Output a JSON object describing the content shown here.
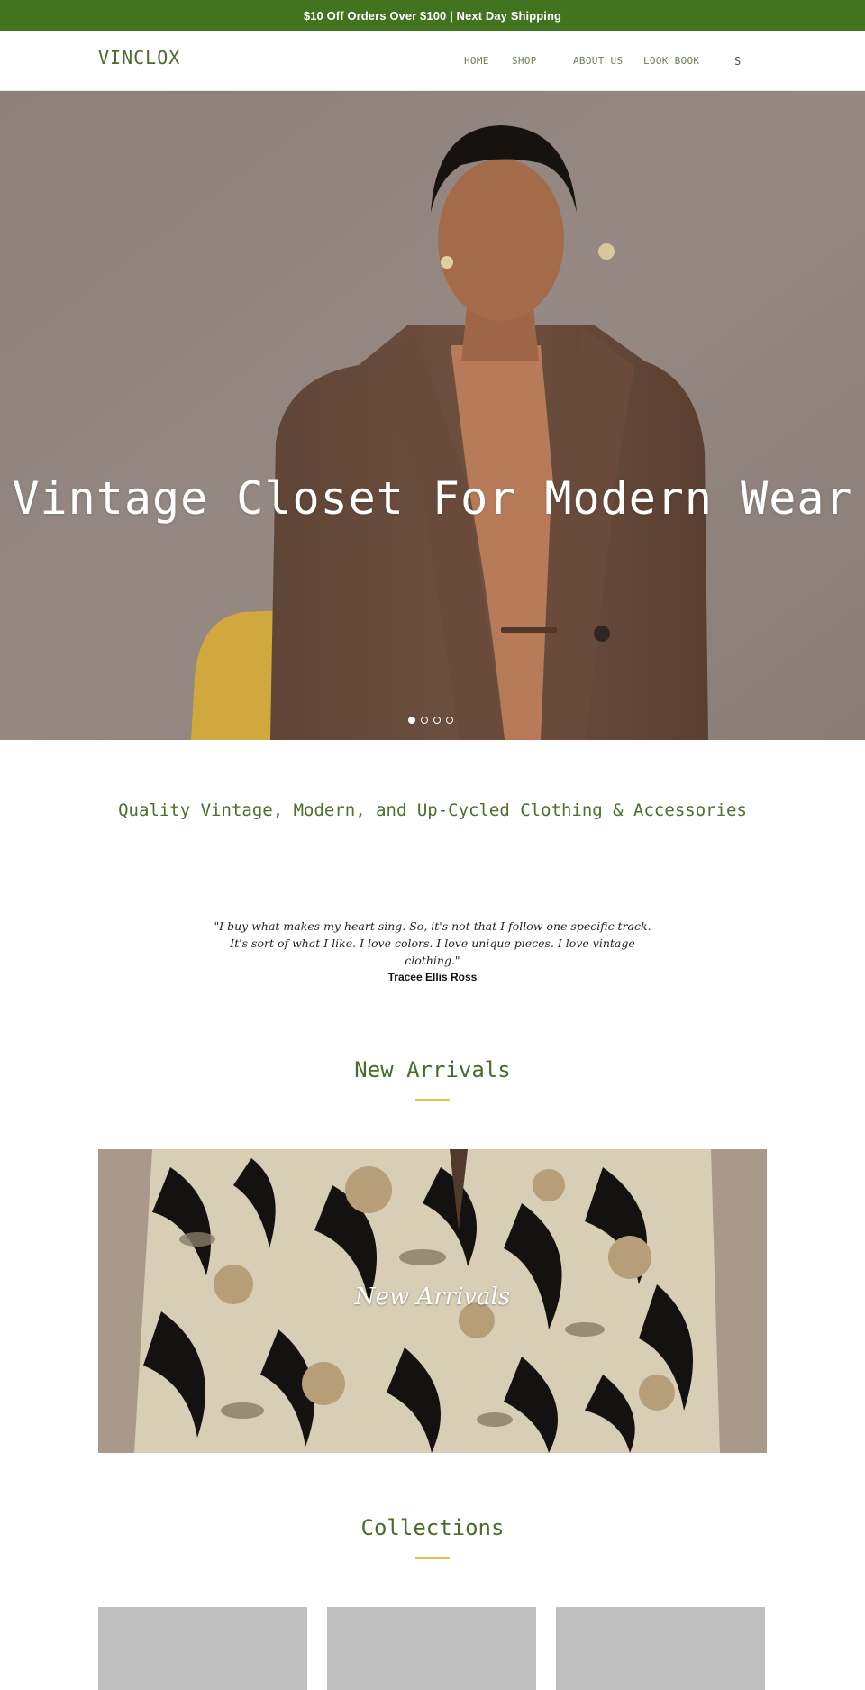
{
  "announcement": {
    "text": "$10 Off Orders Over $100 | Next Day Shipping"
  },
  "header": {
    "logo": "VINCLOX",
    "nav": [
      {
        "label": "HOME"
      },
      {
        "label": "SHOP"
      },
      {
        "label": "ABOUT US"
      },
      {
        "label": "LOOK BOOK"
      }
    ],
    "search_label": "S"
  },
  "hero": {
    "title": "Vintage Closet For Modern Wear",
    "slide_count": 4,
    "active_slide": 1
  },
  "tagline": "Quality Vintage, Modern, and Up-Cycled Clothing & Accessories",
  "quote": {
    "text": "\"I buy what makes my heart sing. So, it's not that I follow one specific track. It's sort of what I like. I love colors. I love unique pieces. I love vintage clothing.\"",
    "author": "Tracee Ellis Ross"
  },
  "new_arrivals": {
    "heading": "New Arrivals",
    "banner_label": "New Arrivals"
  },
  "collections": {
    "heading": "Collections"
  },
  "colors": {
    "brand_green": "#42741f",
    "accent_gold": "#e3c24a",
    "heading_green": "#4a6b2a"
  }
}
